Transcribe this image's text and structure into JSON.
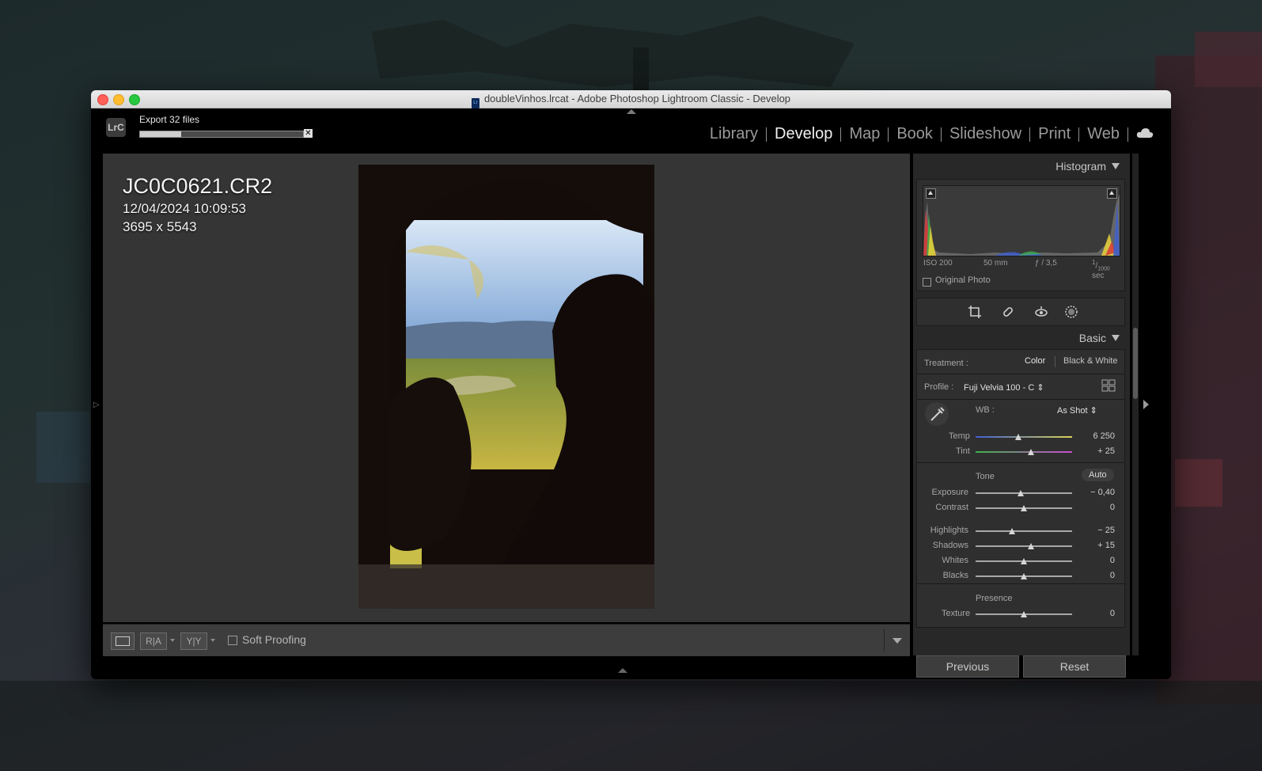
{
  "window": {
    "title": "doubleVinhos.lrcat - Adobe Photoshop Lightroom Classic - Develop",
    "app_icon": "lrc-doc-icon"
  },
  "identity": {
    "logo": "LrC",
    "export_label": "Export 32 files",
    "export_progress": 0.25
  },
  "modules": [
    {
      "label": "Library",
      "active": false
    },
    {
      "label": "Develop",
      "active": true
    },
    {
      "label": "Map",
      "active": false
    },
    {
      "label": "Book",
      "active": false
    },
    {
      "label": "Slideshow",
      "active": false
    },
    {
      "label": "Print",
      "active": false
    },
    {
      "label": "Web",
      "active": false
    }
  ],
  "photo_info": {
    "filename": "JC0C0621.CR2",
    "datetime": "12/04/2024 10:09:53",
    "dimensions": "3695 x 5543"
  },
  "toolbar": {
    "view_loupe": "loupe-view-icon",
    "view_before_after": "R|A",
    "view_yy": "Y|Y",
    "soft_proofing": "Soft Proofing"
  },
  "histogram": {
    "header": "Histogram",
    "iso": "ISO 200",
    "focal": "50 mm",
    "aperture": "ƒ / 3,5",
    "shutter_num": "1",
    "shutter_den": "1000",
    "shutter_unit": "sec",
    "original_photo": "Original Photo"
  },
  "basic": {
    "header": "Basic",
    "treatment_label": "Treatment :",
    "treatment_color": "Color",
    "treatment_bw": "Black & White",
    "profile_label": "Profile :",
    "profile_value": "Fuji Velvia 100 - C",
    "wb_label": "WB :",
    "wb_value": "As Shot",
    "temp_label": "Temp",
    "temp_value": "6 250",
    "temp_pos": 0.44,
    "tint_label": "Tint",
    "tint_value": "+ 25",
    "tint_pos": 0.57,
    "tone_label": "Tone",
    "auto_label": "Auto",
    "sliders": [
      {
        "label": "Exposure",
        "value": "− 0,40",
        "pos": 0.47
      },
      {
        "label": "Contrast",
        "value": "0",
        "pos": 0.5
      },
      {
        "label": "Highlights",
        "value": "− 25",
        "pos": 0.38
      },
      {
        "label": "Shadows",
        "value": "+ 15",
        "pos": 0.57
      },
      {
        "label": "Whites",
        "value": "0",
        "pos": 0.5
      },
      {
        "label": "Blacks",
        "value": "0",
        "pos": 0.5
      }
    ],
    "presence_label": "Presence",
    "texture_label": "Texture",
    "texture_value": "0",
    "texture_pos": 0.5
  },
  "buttons": {
    "previous": "Previous",
    "reset": "Reset"
  }
}
